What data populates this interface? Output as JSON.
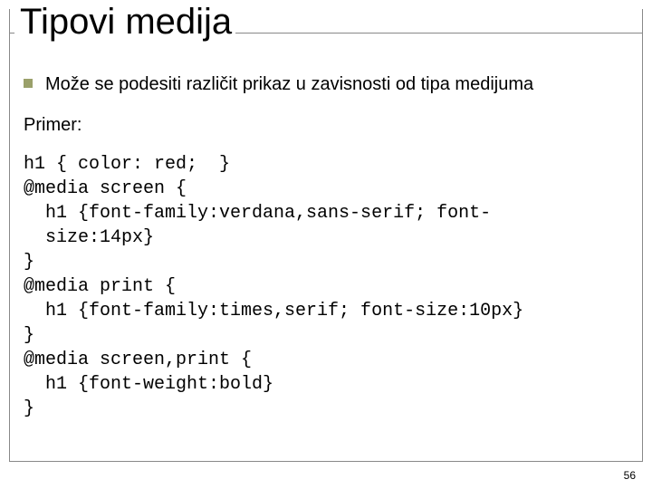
{
  "title": "Tipovi medija",
  "bullet": "Može se podesiti različit prikaz u zavisnosti od tipa medijuma",
  "primer_label": "Primer:",
  "code_lines": [
    "h1 { color: red;  }",
    "@media screen {",
    "  h1 {font-family:verdana,sans-serif; font-",
    "  size:14px}",
    "}",
    "@media print {",
    "  h1 {font-family:times,serif; font-size:10px}",
    "}",
    "@media screen,print {",
    "  h1 {font-weight:bold}",
    "}"
  ],
  "page_number": "56"
}
